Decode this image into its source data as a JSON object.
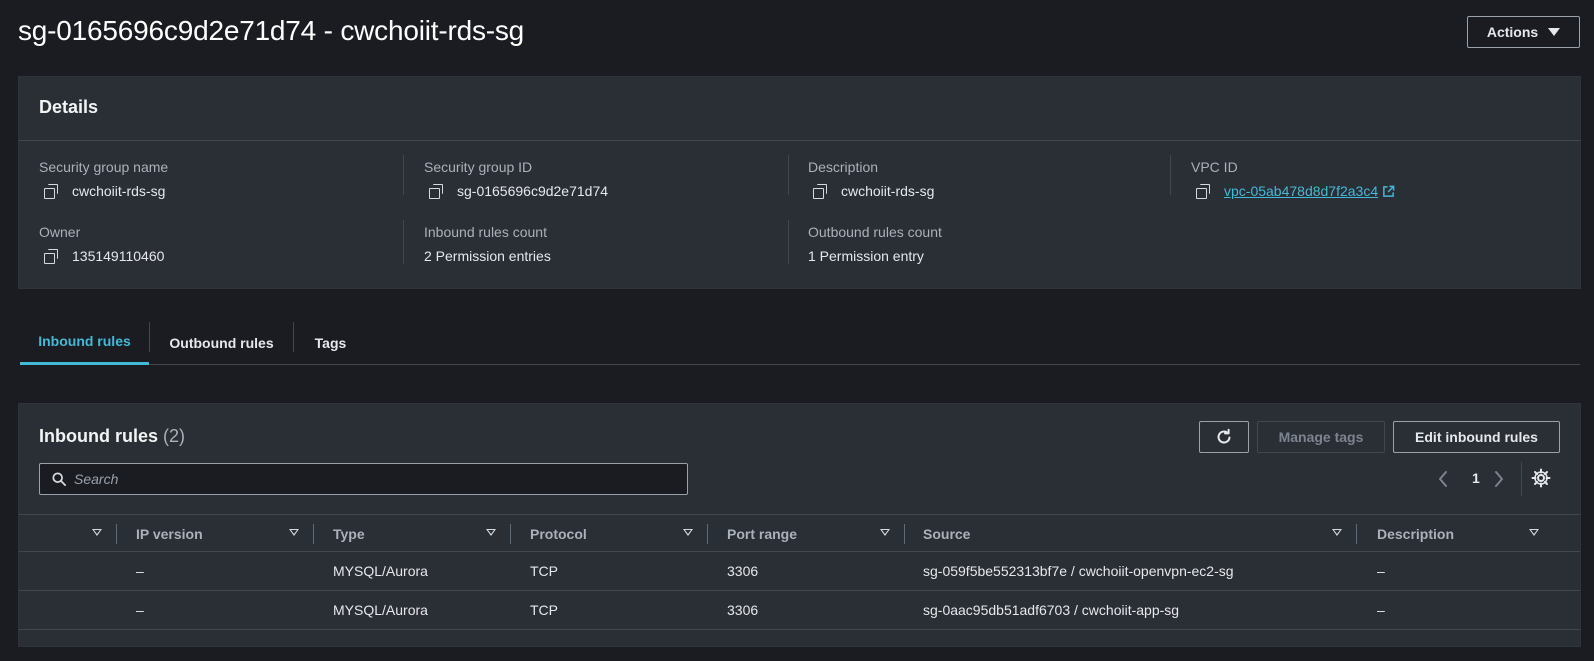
{
  "header": {
    "title": "sg-0165696c9d2e71d74 - cwchoiit-rds-sg",
    "actions_label": "Actions"
  },
  "details": {
    "title": "Details",
    "fields": {
      "sg_name": {
        "label": "Security group name",
        "value": "cwchoiit-rds-sg"
      },
      "sg_id": {
        "label": "Security group ID",
        "value": "sg-0165696c9d2e71d74"
      },
      "description": {
        "label": "Description",
        "value": "cwchoiit-rds-sg"
      },
      "vpc_id": {
        "label": "VPC ID",
        "value": "vpc-05ab478d8d7f2a3c4"
      },
      "owner": {
        "label": "Owner",
        "value": "135149110460"
      },
      "inbound_count": {
        "label": "Inbound rules count",
        "value": "2 Permission entries"
      },
      "outbound_count": {
        "label": "Outbound rules count",
        "value": "1 Permission entry"
      }
    }
  },
  "tabs": [
    {
      "label": "Inbound rules",
      "active": true
    },
    {
      "label": "Outbound rules",
      "active": false
    },
    {
      "label": "Tags",
      "active": false
    }
  ],
  "inbound": {
    "title": "Inbound rules",
    "count": "(2)",
    "buttons": {
      "manage_tags": "Manage tags",
      "edit_rules": "Edit inbound rules"
    },
    "search_placeholder": "Search",
    "page": "1",
    "columns": [
      "",
      "IP version",
      "Type",
      "Protocol",
      "Port range",
      "Source",
      "Description"
    ],
    "rows": [
      {
        "ip_version": "–",
        "type": "MYSQL/Aurora",
        "protocol": "TCP",
        "port_range": "3306",
        "source": "sg-059f5be552313bf7e / cwchoiit-openvpn-ec2-sg",
        "description": "–"
      },
      {
        "ip_version": "–",
        "type": "MYSQL/Aurora",
        "protocol": "TCP",
        "port_range": "3306",
        "source": "sg-0aac95db51adf6703 / cwchoiit-app-sg",
        "description": "–"
      }
    ]
  },
  "colors": {
    "background": "#1a1c22",
    "panel": "#2a2e35",
    "accent_link": "#44b9d6",
    "text_primary": "#e6e8eb",
    "text_secondary": "#aab1ba"
  }
}
